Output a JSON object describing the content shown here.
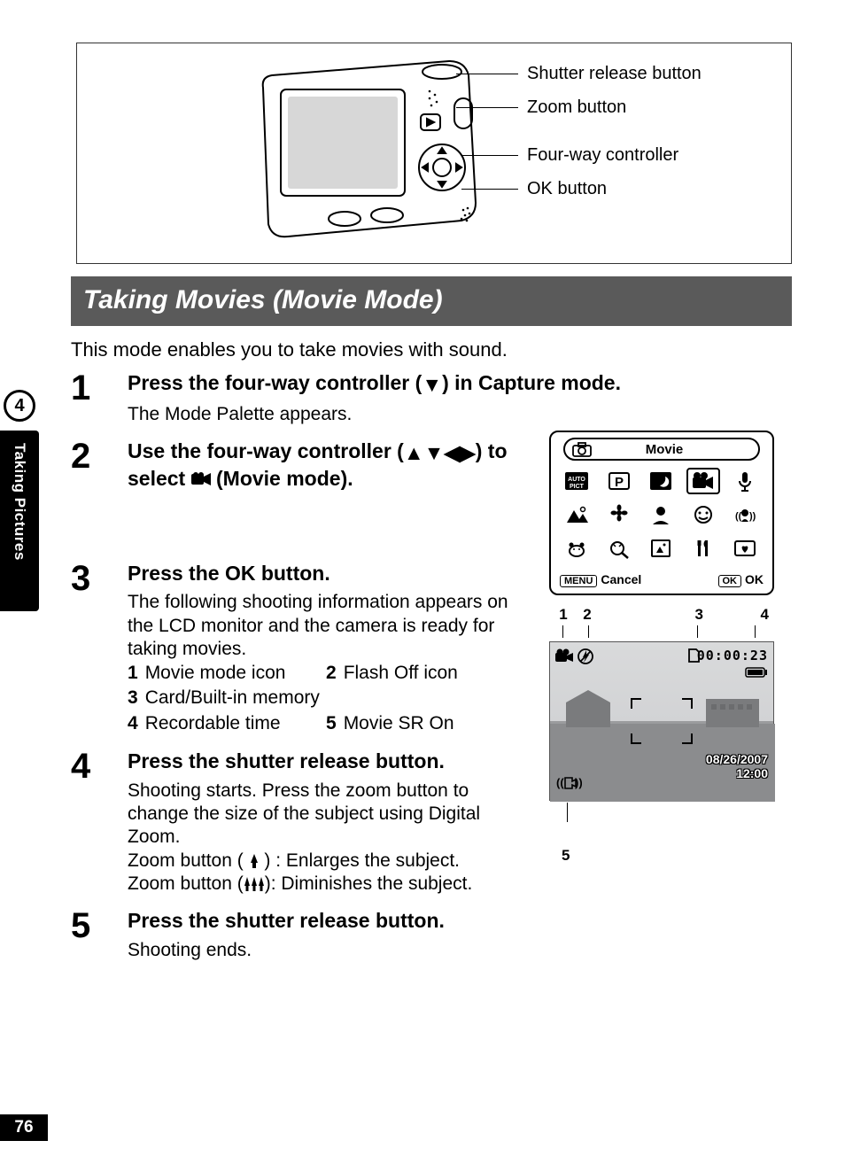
{
  "diagram": {
    "callouts": [
      "Shutter release button",
      "Zoom button",
      "Four-way controller",
      "OK button"
    ]
  },
  "section_title": "Taking Movies (Movie Mode)",
  "intro": "This mode enables you to take movies with sound.",
  "steps": [
    {
      "num": "1",
      "head_pre": "Press the four-way controller (",
      "head_post": ") in Capture mode.",
      "sub": "The Mode Palette appears."
    },
    {
      "num": "2",
      "head_pre": "Use the four-way controller (",
      "head_mid": ") to select ",
      "head_post": " (Movie mode)."
    },
    {
      "num": "3",
      "head": "Press the OK button.",
      "sub": "The following shooting information appears on the LCD monitor and the camera is ready for taking movies.",
      "legend": [
        {
          "n": "1",
          "t": "Movie mode icon"
        },
        {
          "n": "2",
          "t": "Flash Off icon"
        },
        {
          "n": "3",
          "t": "Card/Built-in memory"
        },
        {
          "n": "4",
          "t": "Recordable time"
        },
        {
          "n": "5",
          "t": "Movie SR On"
        }
      ]
    },
    {
      "num": "4",
      "head": "Press the shutter release button.",
      "sub": "Shooting starts. Press the zoom button to change the size of the subject using Digital Zoom.",
      "zoom_tele": "Zoom button ( ♣ ) : Enlarges the subject.",
      "zoom_wide": "Zoom button (♣♣♣): Diminishes the subject."
    },
    {
      "num": "5",
      "head": "Press the shutter release button.",
      "sub": "Shooting ends."
    }
  ],
  "palette": {
    "title": "Movie",
    "menu_label": "MENU",
    "cancel": "Cancel",
    "ok_label": "OK",
    "ok": "OK",
    "icons": [
      "auto-pict",
      "program",
      "night",
      "movie",
      "voice",
      "landscape",
      "flower",
      "portrait",
      "kids",
      "sr",
      "pet",
      "digital-sr",
      "frame",
      "food",
      "love"
    ],
    "selected_index": 3
  },
  "preview": {
    "markers": [
      "1",
      "2",
      "3",
      "4"
    ],
    "rec_time": "00:00:23",
    "date": "08/26/2007",
    "time": "12:00",
    "marker5": "5"
  },
  "side": {
    "chapter_num": "4",
    "chapter_title": "Taking Pictures"
  },
  "page_number": "76"
}
